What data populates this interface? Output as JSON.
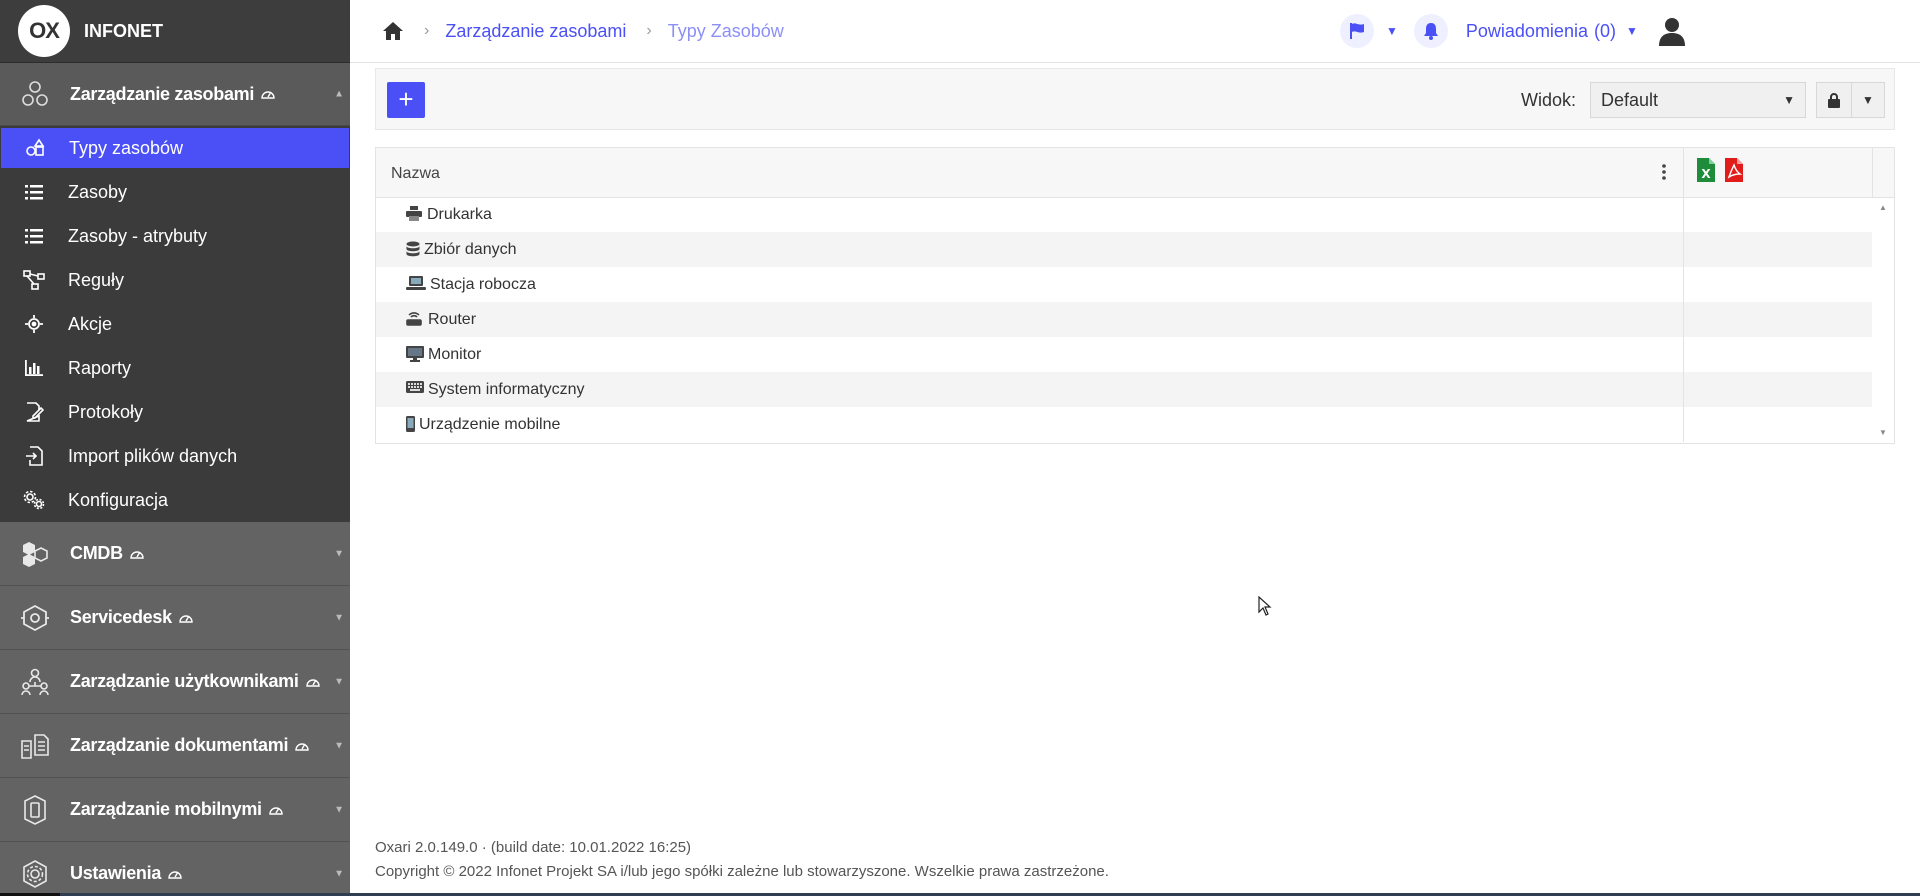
{
  "brand": {
    "logo_text": "OX",
    "name": "INFONET"
  },
  "sidebar": {
    "active_section": {
      "label": "Zarządzanie zasobami",
      "icon": "resources-icon"
    },
    "items": [
      {
        "label": "Typy zasobów",
        "icon": "shapes-icon",
        "active": true
      },
      {
        "label": "Zasoby",
        "icon": "list-icon"
      },
      {
        "label": "Zasoby - atrybuty",
        "icon": "list-icon"
      },
      {
        "label": "Reguły",
        "icon": "flow-icon"
      },
      {
        "label": "Akcje",
        "icon": "target-icon"
      },
      {
        "label": "Raporty",
        "icon": "bar-chart-icon"
      },
      {
        "label": "Protokoły",
        "icon": "edit-doc-icon"
      },
      {
        "label": "Import plików danych",
        "icon": "import-icon"
      },
      {
        "label": "Konfiguracja",
        "icon": "gears-icon"
      }
    ],
    "sections": [
      {
        "label": "CMDB",
        "icon": "cmdb-icon"
      },
      {
        "label": "Servicedesk",
        "icon": "servicedesk-icon"
      },
      {
        "label": "Zarządzanie użytkownikami",
        "icon": "users-icon"
      },
      {
        "label": "Zarządzanie dokumentami",
        "icon": "documents-icon"
      },
      {
        "label": "Zarządzanie mobilnymi",
        "icon": "mobile-icon"
      },
      {
        "label": "Ustawienia",
        "icon": "settings-icon"
      }
    ]
  },
  "topbar": {
    "breadcrumb": {
      "link": "Zarządzanie zasobami",
      "current": "Typy Zasobów"
    },
    "notifications_label": "Powiadomienia",
    "notifications_count": "(0)"
  },
  "toolbar": {
    "add_label": "+",
    "view_label": "Widok:",
    "view_value": "Default"
  },
  "grid": {
    "column_name": "Nazwa",
    "rows": [
      {
        "label": "Drukarka",
        "icon": "printer-icon"
      },
      {
        "label": "Zbiór danych",
        "icon": "database-icon"
      },
      {
        "label": "Stacja robocza",
        "icon": "laptop-icon"
      },
      {
        "label": "Router",
        "icon": "router-icon"
      },
      {
        "label": "Monitor",
        "icon": "monitor-icon"
      },
      {
        "label": "System informatyczny",
        "icon": "keyboard-icon"
      },
      {
        "label": "Urządzenie mobilne",
        "icon": "phone-icon"
      }
    ]
  },
  "footer": {
    "version": "Oxari 2.0.149.0  ·  (build date: 10.01.2022 16:25)",
    "copyright": "Copyright © 2022 Infonet Projekt SA i/lub jego spółki zależne lub stowarzyszone. Wszelkie prawa zastrzeżone."
  },
  "colors": {
    "accent": "#4a50f5",
    "sidebar_bg": "#3b3b3b",
    "section_bg": "#5a5a5a"
  }
}
